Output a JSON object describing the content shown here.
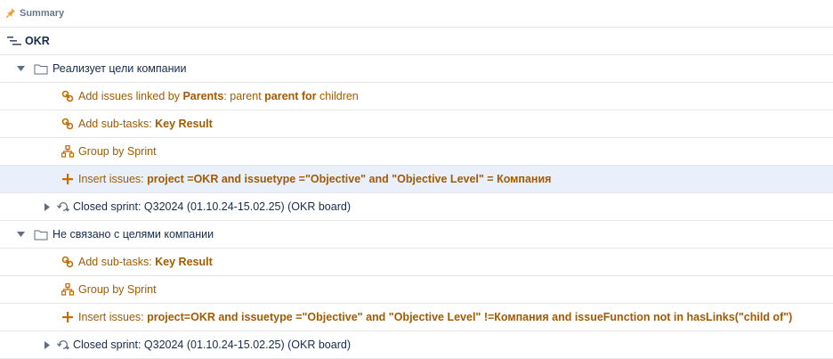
{
  "header": {
    "title": "Summary"
  },
  "root": {
    "label": "OKR"
  },
  "groups": [
    {
      "label": "Реализует цели компании",
      "rules": [
        {
          "prefix": "Add issues linked by ",
          "b1": "Parents",
          "mid1": ": parent ",
          "b2": "parent for",
          "tail": " children"
        },
        {
          "prefix": "Add sub-tasks: ",
          "b1": "Key Result"
        },
        {
          "prefix": "Group by Sprint"
        },
        {
          "prefix": "Insert issues: ",
          "b1": "project =OKR and issuetype =\"Objective\" and \"Objective Level\" = Компания"
        }
      ],
      "sprint": "Closed sprint: Q32024 (01.10.24-15.02.25) (OKR board)"
    },
    {
      "label": "Не связано с целями компании",
      "rules": [
        {
          "prefix": "Add sub-tasks: ",
          "b1": "Key Result"
        },
        {
          "prefix": "Group by Sprint"
        },
        {
          "prefix": "Insert issues: ",
          "b1": "project=OKR and issuetype =\"Objective\" and \"Objective Level\" !=Компания and issueFunction not in hasLinks(\"child of\")"
        }
      ],
      "sprint": "Closed sprint: Q32024 (01.10.24-15.02.25) (OKR board)"
    }
  ],
  "colors": {
    "rule": "#a35a00",
    "highlight": "#e9f0fb",
    "border": "#e4e6ea"
  },
  "icons": [
    "pin-icon",
    "hierarchy-icon",
    "chevron-down-icon",
    "chevron-right-icon",
    "folder-icon",
    "link-icon",
    "group-icon",
    "plus-icon",
    "sprint-icon"
  ]
}
